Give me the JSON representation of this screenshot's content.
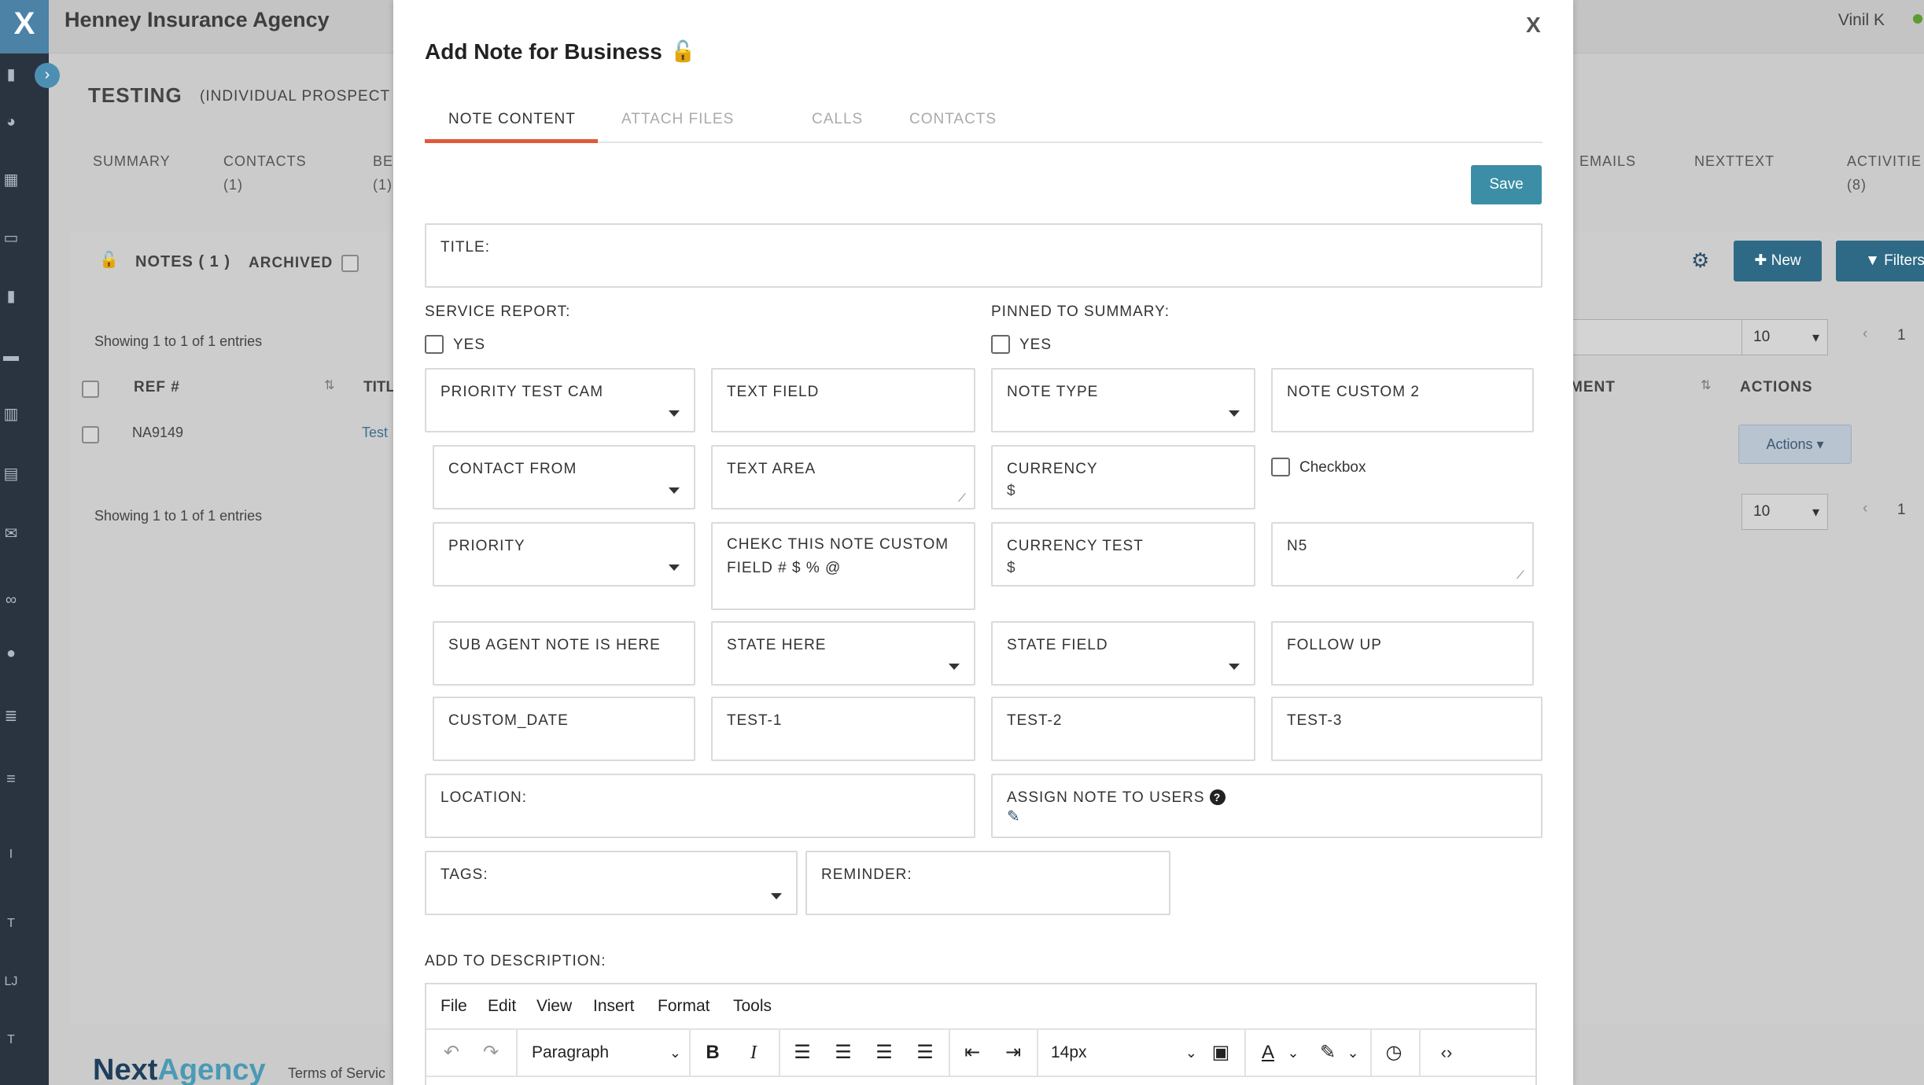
{
  "app": {
    "logo_text": "X",
    "agency_name": "Henney Insurance Agency",
    "user_name": "Vinil K",
    "record_name": "TESTING",
    "record_type": "(INDIVIDUAL PROSPECT",
    "tabs": [
      {
        "label": "SUMMARY",
        "count": ""
      },
      {
        "label": "CONTACTS",
        "count": "(1)"
      },
      {
        "label": "BE",
        "count": "(1)"
      },
      {
        "label": "EMAILS",
        "count": ""
      },
      {
        "label": "NEXTTEXT",
        "count": ""
      },
      {
        "label": "ACTIVITIE",
        "count": "(8)"
      }
    ],
    "notes_heading": "NOTES ( 1 )",
    "archived_label": "ARCHIVED",
    "showing_text": "Showing 1 to 1 of 1 entries",
    "table": {
      "col_ref": "REF #",
      "col_title": "TITL",
      "col_ment": "MENT",
      "col_actions": "ACTIONS",
      "row_ref": "NA9149",
      "row_title": "Test",
      "actions_label": "Actions"
    },
    "new_label": "New",
    "filters_label": "Filters",
    "page_size": "10",
    "page_num": "1",
    "footer_brand_a": "Next",
    "footer_brand_b": "Agency",
    "footer_terms": "Terms of Servic"
  },
  "modal": {
    "title": "Add Note for Business",
    "close_label": "X",
    "tabs": [
      "NOTE CONTENT",
      "ATTACH FILES",
      "CALLS",
      "CONTACTS"
    ],
    "save_label": "Save",
    "title_field": "TITLE:",
    "service_report_label": "SERVICE REPORT:",
    "pinned_label": "PINNED TO SUMMARY:",
    "yes_label": "YES",
    "fields": {
      "priority_test_cam": "PRIORITY TEST CAM",
      "text_field": "TEXT FIELD",
      "note_type": "NOTE TYPE",
      "note_custom_2": "NOTE CUSTOM 2",
      "contact_from": "CONTACT FROM",
      "text_area": "TEXT AREA",
      "currency": "CURRENCY",
      "currency_symbol": "$",
      "checkbox_label": "Checkbox",
      "priority": "PRIORITY",
      "chekc_line1": "CHEKC THIS NOTE CUSTOM",
      "chekc_line2": "FIELD # $ % @",
      "currency_test": "CURRENCY TEST",
      "n5": "N5",
      "sub_agent": "SUB AGENT NOTE IS HERE",
      "state_here": "STATE HERE",
      "state_field": "STATE FIELD",
      "follow_up": "FOLLOW UP",
      "custom_date": "CUSTOM_DATE",
      "test1": "TEST-1",
      "test2": "TEST-2",
      "test3": "TEST-3",
      "location": "LOCATION:",
      "assign_users": "ASSIGN NOTE TO USERS",
      "tags": "TAGS:",
      "reminder": "REMINDER:"
    },
    "description_label": "ADD TO DESCRIPTION:",
    "editor": {
      "menus": [
        "File",
        "Edit",
        "View",
        "Insert",
        "Format",
        "Tools"
      ],
      "block_format": "Paragraph",
      "font_size": "14px"
    }
  }
}
